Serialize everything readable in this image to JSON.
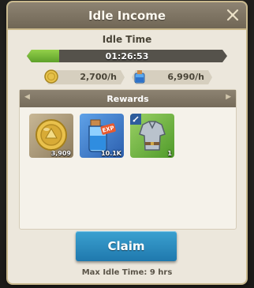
{
  "dialog": {
    "title": "Idle Income"
  },
  "idle": {
    "label": "Idle Time",
    "timer": "01:26:53",
    "progress_fraction": 0.16
  },
  "rates": [
    {
      "icon": "gold-coin-icon",
      "value": "2,700/h"
    },
    {
      "icon": "exp-potion-icon",
      "value": "6,990/h"
    }
  ],
  "rewards": {
    "title": "Rewards",
    "items": [
      {
        "icon": "gold-coin-icon",
        "count": "3,909",
        "rarity_color": "#b3a27f"
      },
      {
        "icon": "exp-potion-icon",
        "count": "10.1K",
        "rarity_color": "#3f7fd1"
      },
      {
        "icon": "armor-icon",
        "count": "1",
        "rarity_color": "#74b744"
      }
    ]
  },
  "claim_button": {
    "label": "Claim"
  },
  "max_idle": {
    "text": "Max Idle Time: 9 hrs"
  },
  "colors": {
    "accent_blue": "#2a8ac0",
    "progress_green": "#7cbf3b",
    "panel": "#ece7dc"
  }
}
